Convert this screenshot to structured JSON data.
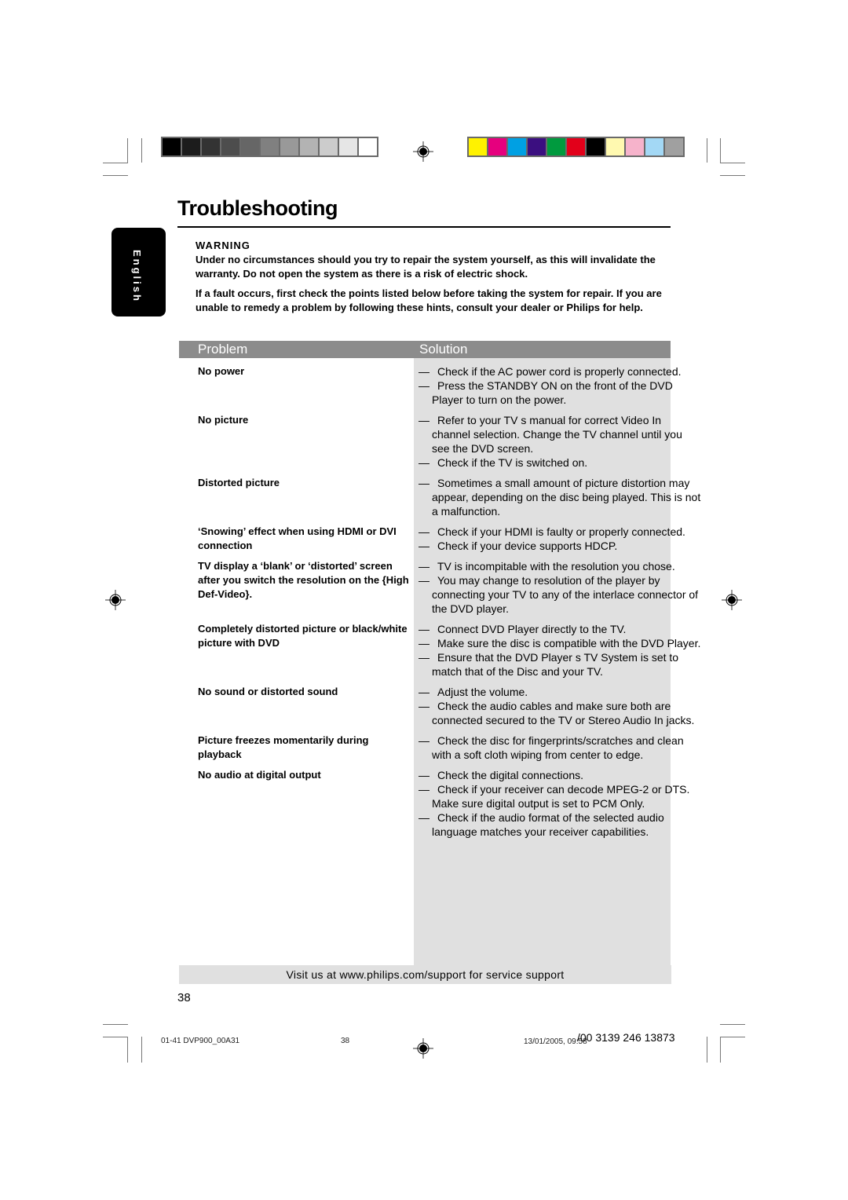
{
  "printer_marks": {
    "gray_swatches": [
      "#000000",
      "#1c1c1c",
      "#333333",
      "#4d4d4d",
      "#666666",
      "#808080",
      "#999999",
      "#b3b3b3",
      "#cccccc",
      "#e6e6e6",
      "#ffffff"
    ],
    "color_swatches": [
      "#fff200",
      "#e6007e",
      "#00a0e3",
      "#3b0f80",
      "#009a3e",
      "#e2001a",
      "#000000",
      "#fff9b0",
      "#f6b3cb",
      "#a3d8f5",
      "#a0a0a0"
    ]
  },
  "page": {
    "title": "Troubleshooting",
    "language_tab": "English",
    "warning": {
      "heading": "WARNING",
      "text": "Under no circumstances should you try to repair the system yourself, as this will invalidate the warranty.  Do not open the system as there is a risk of electric shock.",
      "intro": "If a fault occurs, first check the points listed below before taking the system for repair. If you are unable to remedy a problem by following these hints, consult your dealer or Philips for help."
    },
    "table": {
      "header_problem": "Problem",
      "header_solution": "Solution",
      "dash": "—",
      "rows": [
        {
          "problem": "No power",
          "solutions": [
            "Check if the AC power cord is properly connected.",
            "Press the STANDBY ON on the front of the DVD Player to turn on the power."
          ]
        },
        {
          "problem": "No picture",
          "solutions": [
            "Refer to your TV s manual for correct Video In channel selection.  Change the TV channel until you see the DVD screen.",
            "Check if the TV is switched on."
          ]
        },
        {
          "problem": "Distorted picture",
          "solutions": [
            "Sometimes a small amount of picture distortion may appear, depending on the disc being played. This is not a malfunction."
          ]
        },
        {
          "problem": "‘Snowing’ effect when using HDMI or DVI connection",
          "solutions": [
            "Check if your HDMI is faulty or properly connected.",
            "Check if your device supports HDCP."
          ]
        },
        {
          "problem": "TV display a ‘blank’ or ‘distorted’ screen after you switch the resolution on the {High Def-Video}.",
          "solutions": [
            "TV is incompitable with the resolution you chose.",
            "You may change to resolution of the player by connecting your TV to any of the interlace connector of the DVD player."
          ]
        },
        {
          "problem": "Completely distorted picture or black/white picture with DVD",
          "solutions": [
            "Connect DVD Player directly to the TV.",
            "Make sure the disc is compatible with the DVD Player.",
            "Ensure that the DVD Player s TV System is set to match that of the Disc and your TV."
          ]
        },
        {
          "problem": "No sound or distorted sound",
          "solutions": [
            "Adjust the volume.",
            "Check the audio cables and make sure both are connected secured to the TV or Stereo Audio In jacks."
          ]
        },
        {
          "problem": "Picture freezes momentarily during playback",
          "solutions": [
            "Check the disc for fingerprints/scratches and clean with a soft cloth wiping from center to edge."
          ]
        },
        {
          "problem": "No audio at digital output",
          "solutions": [
            "Check the digital connections.",
            "Check if your receiver can decode MPEG-2 or DTS. Make sure digital output is set to PCM Only.",
            "Check if the audio format of the selected audio language matches your receiver capabilities."
          ]
        }
      ]
    },
    "footer_support": "Visit us at www.philips.com/support for service support",
    "page_number": "38"
  },
  "slug": {
    "file": "01-41 DVP900_00A31",
    "page": "38",
    "datetime": "13/01/2005, 09:58",
    "code": "/00  3139 246 13873"
  }
}
